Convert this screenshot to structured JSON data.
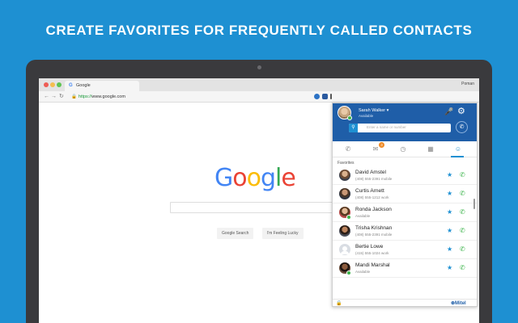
{
  "headline": "CREATE FAVORITES FOR FREQUENTLY CALLED CONTACTS",
  "colors": {
    "brand_blue": "#1e90d2",
    "panel_header": "#1f5ea8",
    "available_green": "#3cb44b",
    "badge_orange": "#f08a24"
  },
  "browser": {
    "tab_title": "Google",
    "tab_favicon": "G",
    "user_name": "Poman",
    "address_https": "https://",
    "address_rest": "www.google.com",
    "back_icon": "arrow-left-icon",
    "forward_icon": "arrow-right-icon",
    "reload_icon": "reload-icon"
  },
  "google": {
    "logo_letters": [
      "G",
      "o",
      "o",
      "g",
      "l",
      "e"
    ],
    "search_button": "Google Search",
    "lucky_button": "I'm Feeling Lucky"
  },
  "panel": {
    "user_name": "Sarah Walker",
    "user_status": "Available",
    "search_placeholder": "Enter a name or number",
    "tabs": [
      {
        "icon": "phone-history-icon"
      },
      {
        "icon": "chat-icon",
        "badge": "3"
      },
      {
        "icon": "clock-icon"
      },
      {
        "icon": "dialpad-icon"
      },
      {
        "icon": "contacts-icon",
        "active": true
      }
    ],
    "favorites_label": "Favorites",
    "contacts": [
      {
        "name": "David Amstel",
        "sub": "(408) 555-2391 mobile",
        "photo": true,
        "available": false
      },
      {
        "name": "Curtis Arnett",
        "sub": "(408) 555-1212 work",
        "photo": true,
        "available": false
      },
      {
        "name": "Ronda Jackson",
        "sub": "Available",
        "photo": true,
        "available": true
      },
      {
        "name": "Trisha Krishnan",
        "sub": "(408) 555-2391 mobile",
        "photo": true,
        "available": false
      },
      {
        "name": "Bertie Lowe",
        "sub": "(415) 555-1024 work",
        "photo": false,
        "available": false
      },
      {
        "name": "Mandi Marshal",
        "sub": "Available",
        "photo": true,
        "available": true
      }
    ],
    "footer_brand": "Mitel"
  }
}
